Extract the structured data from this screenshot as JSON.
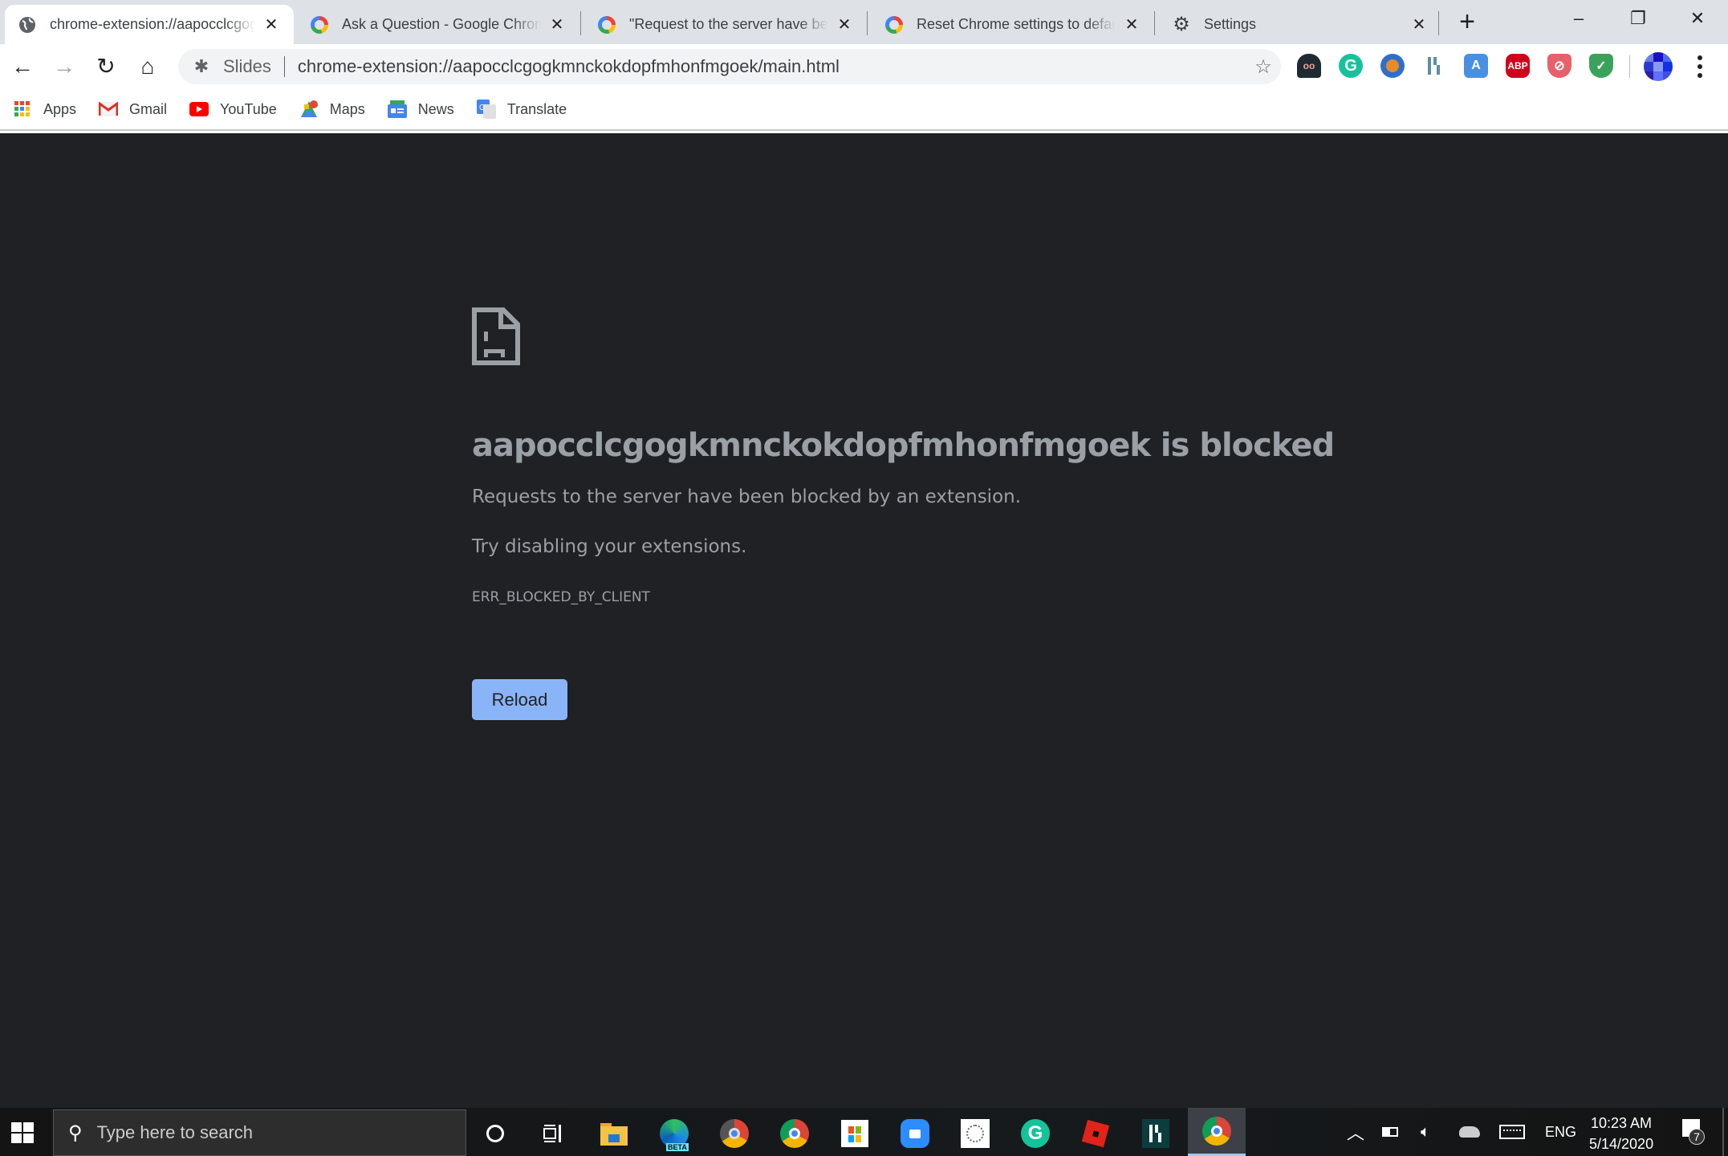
{
  "browser": {
    "tabs": [
      {
        "title": "chrome-extension://aapocclcgogkmnckokdopfmhonfmgoek/main.html",
        "icon": "globe-icon",
        "active": true
      },
      {
        "title": "Ask a Question - Google Chrome Help",
        "icon": "google-icon",
        "active": false
      },
      {
        "title": "\"Request to the server have been blocked by an extension\"",
        "icon": "google-icon",
        "active": false
      },
      {
        "title": "Reset Chrome settings to default",
        "icon": "google-icon",
        "active": false
      },
      {
        "title": "Settings",
        "icon": "gear-icon",
        "active": false
      }
    ],
    "new_tab_label": "+",
    "window_controls": {
      "minimize": "–",
      "restore": "❐",
      "close": "✕"
    },
    "toolbar": {
      "back": "←",
      "forward": "→",
      "reload": "↻",
      "home": "⌂",
      "omnibox": {
        "chip_label": "Slides",
        "url": "chrome-extension://aapocclcgogkmnckokdopfmhonfmgoek/main.html",
        "star": "☆"
      },
      "extensions": [
        {
          "name": "dark-reader-extension-icon",
          "label": "",
          "color": "#1f2b33"
        },
        {
          "name": "grammarly-extension-icon",
          "label": "G",
          "color": "#15c39a"
        },
        {
          "name": "cleaner-extension-icon",
          "label": "",
          "color": "#2f6fcc"
        },
        {
          "name": "dashlane-extension-icon",
          "label": "",
          "color": "#5a8fa6"
        },
        {
          "name": "translate-extension-icon",
          "label": "A",
          "color": "#4a90e2"
        },
        {
          "name": "adblock-plus-extension-icon",
          "label": "ABP",
          "color": "#d0021b"
        },
        {
          "name": "shield-block-extension-icon",
          "label": "⊘",
          "color": "#e8606a"
        },
        {
          "name": "password-check-extension-icon",
          "label": "✓",
          "color": "#3ba25b"
        }
      ]
    },
    "bookmarks": [
      {
        "label": "Apps",
        "icon": "apps-grid-icon"
      },
      {
        "label": "Gmail",
        "icon": "gmail-icon"
      },
      {
        "label": "YouTube",
        "icon": "youtube-icon"
      },
      {
        "label": "Maps",
        "icon": "maps-icon"
      },
      {
        "label": "News",
        "icon": "news-icon"
      },
      {
        "label": "Translate",
        "icon": "translate-icon"
      }
    ]
  },
  "page": {
    "title": "aapocclcgogkmnckokdopfmhonfmgoek is blocked",
    "description": "Requests to the server have been blocked by an extension.",
    "hint": "Try disabling your extensions.",
    "error_code": "ERR_BLOCKED_BY_CLIENT",
    "reload_label": "Reload"
  },
  "taskbar": {
    "search_placeholder": "Type here to search",
    "pinned": [
      "cortana",
      "task-view",
      "file-explorer",
      "edge-beta",
      "chrome-beta",
      "chrome",
      "microsoft-store",
      "zoom",
      "app",
      "grammarly",
      "roblox",
      "dashlane",
      "chrome-active"
    ],
    "tray": {
      "language": "ENG",
      "time": "10:23 AM",
      "date": "5/14/2020",
      "notification_count": "7"
    }
  }
}
